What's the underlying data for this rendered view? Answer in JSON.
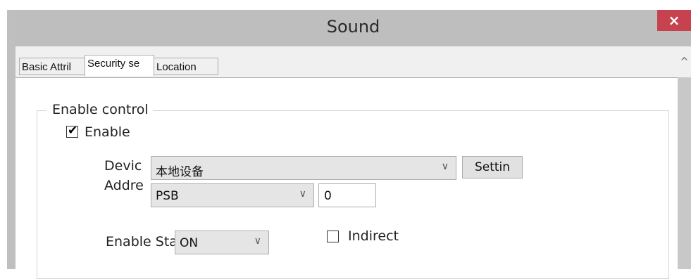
{
  "window": {
    "title": "Sound",
    "close_glyph": "×"
  },
  "tabs": [
    {
      "label": "Basic Attril",
      "active": false
    },
    {
      "label": "Security se",
      "active": true
    },
    {
      "label": "Location",
      "active": false
    }
  ],
  "scrollbar": {
    "up_glyph": "^"
  },
  "enable_control": {
    "group_label": "Enable control",
    "enable_checkbox": {
      "label": "Enable",
      "checked": true,
      "mark": "✔"
    },
    "device": {
      "label": "Devic",
      "value": "本地设备",
      "settings_label": "Settin"
    },
    "address": {
      "label": "Addre",
      "type_value": "PSB",
      "value": "0"
    },
    "enable_state": {
      "label": "Enable Sta",
      "value": "ON"
    },
    "indirect_checkbox": {
      "label": "Indirect",
      "checked": false
    }
  },
  "icons": {
    "chevron": "∨"
  }
}
